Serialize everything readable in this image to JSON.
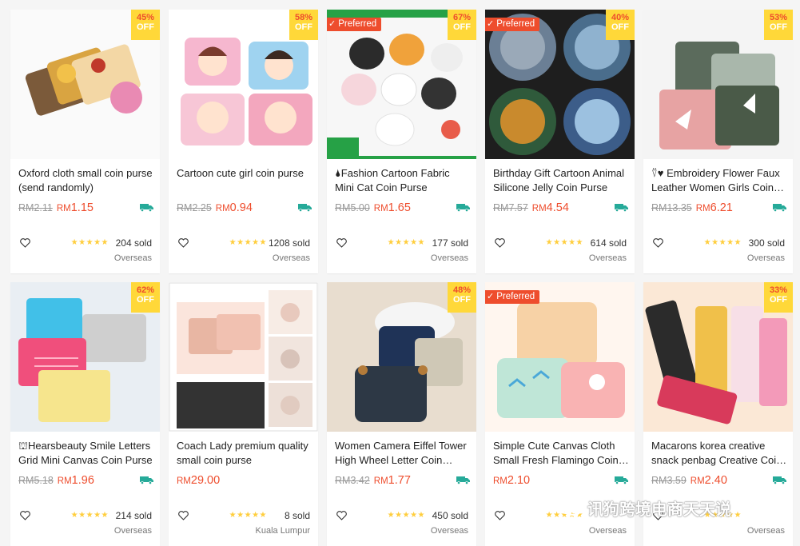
{
  "colors": {
    "accent": "#ee4d2d",
    "badge_bg": "#ffd839",
    "star": "#ffce3d",
    "ship": "#26aa99"
  },
  "badge_off_label": "OFF",
  "preferred_label": "Preferred",
  "products": [
    {
      "title": "Oxford cloth small coin purse (send randomly)",
      "old_price": "RM2.11",
      "currency": "RM",
      "price": "1.15",
      "discount": "45%",
      "preferred": false,
      "rating": 5,
      "sold": "204 sold",
      "location": "Overseas",
      "free_ship": true
    },
    {
      "title": "Cartoon cute girl coin purse",
      "old_price": "RM2.25",
      "currency": "RM",
      "price": "0.94",
      "discount": "58%",
      "preferred": false,
      "rating": 5,
      "sold": "1208 sold",
      "location": "Overseas",
      "free_ship": true
    },
    {
      "title": "🌢Fashion Cartoon Fabric Mini Cat Coin Purse",
      "old_price": "RM5.00",
      "currency": "RM",
      "price": "1.65",
      "discount": "67%",
      "preferred": true,
      "rating": 5,
      "sold": "177 sold",
      "location": "Overseas",
      "free_ship": true
    },
    {
      "title": "Birthday Gift Cartoon Animal Silicone Jelly Coin Purse",
      "old_price": "RM7.57",
      "currency": "RM",
      "price": "4.54",
      "discount": "40%",
      "preferred": true,
      "rating": 5,
      "sold": "614 sold",
      "location": "Overseas",
      "free_ship": true
    },
    {
      "title": "⍢♥ Embroidery Flower Faux Leather Women Girls Coin Purse",
      "old_price": "RM13.35",
      "currency": "RM",
      "price": "6.21",
      "discount": "53%",
      "preferred": false,
      "rating": 5,
      "sold": "300 sold",
      "location": "Overseas",
      "free_ship": true
    },
    {
      "title": "⛫Hearsbeauty Smile Letters Grid Mini Canvas Coin Purse",
      "old_price": "RM5.18",
      "currency": "RM",
      "price": "1.96",
      "discount": "62%",
      "preferred": false,
      "rating": 5,
      "sold": "214 sold",
      "location": "Overseas",
      "free_ship": true
    },
    {
      "title": "Coach Lady premium quality small coin purse",
      "old_price": "",
      "currency": "RM",
      "price": "29.00",
      "discount": "",
      "preferred": false,
      "rating": 5,
      "sold": "8 sold",
      "location": "Kuala Lumpur",
      "free_ship": false
    },
    {
      "title": "Women Camera Eiffel Tower High Wheel Letter Coin Purse",
      "old_price": "RM3.42",
      "currency": "RM",
      "price": "1.77",
      "discount": "48%",
      "preferred": false,
      "rating": 5,
      "sold": "450 sold",
      "location": "Overseas",
      "free_ship": true
    },
    {
      "title": "Simple Cute Canvas Cloth Small Fresh Flamingo Coin Purse",
      "old_price": "",
      "currency": "RM",
      "price": "2.10",
      "discount": "",
      "preferred": true,
      "rating": 5,
      "sold": "",
      "location": "Overseas",
      "free_ship": true
    },
    {
      "title": "Macarons korea creative snack penbag Creative Coin Purse",
      "old_price": "RM3.59",
      "currency": "RM",
      "price": "2.40",
      "discount": "33%",
      "preferred": false,
      "rating": 5,
      "sold": "",
      "location": "Overseas",
      "free_ship": true
    }
  ],
  "watermark": {
    "text": "讯狗跨境电商天天说"
  }
}
